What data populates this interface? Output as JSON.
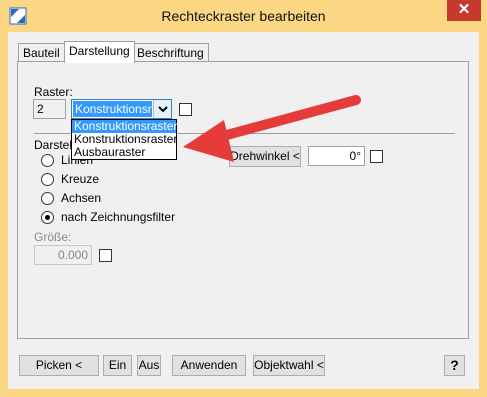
{
  "window": {
    "title": "Rechteckraster bearbeiten",
    "close_symbol": "✕",
    "icon": "app-logo-icon"
  },
  "tabs": [
    {
      "label": "Bauteil",
      "active": false
    },
    {
      "label": "Darstellung",
      "active": true
    },
    {
      "label": "Beschriftung",
      "active": false
    }
  ],
  "raster": {
    "label": "Raster:",
    "number": "2",
    "selected": "Konstruktionsras",
    "options": [
      "Konstruktionsraster",
      "Konstruktionsraster",
      "Ausbauraster"
    ],
    "highlighted_index": 0
  },
  "darstellung": {
    "label": "Darstell",
    "radios": [
      {
        "label": "Linien",
        "checked": false
      },
      {
        "label": "Kreuze",
        "checked": false
      },
      {
        "label": "Achsen",
        "checked": false
      },
      {
        "label": "nach Zeichnungsfilter",
        "checked": true
      }
    ]
  },
  "drehwinkel": {
    "button_label": "Drehwinkel <",
    "value": "0°"
  },
  "groesse": {
    "label": "Größe:",
    "value": "0.000"
  },
  "footer": {
    "picken": "Picken <",
    "ein": "Ein",
    "aus": "Aus",
    "anwenden": "Anwenden",
    "objektwahl": "Objektwahl <",
    "help": "?"
  },
  "annotation": {
    "arrow_color": "#e53b3b"
  }
}
